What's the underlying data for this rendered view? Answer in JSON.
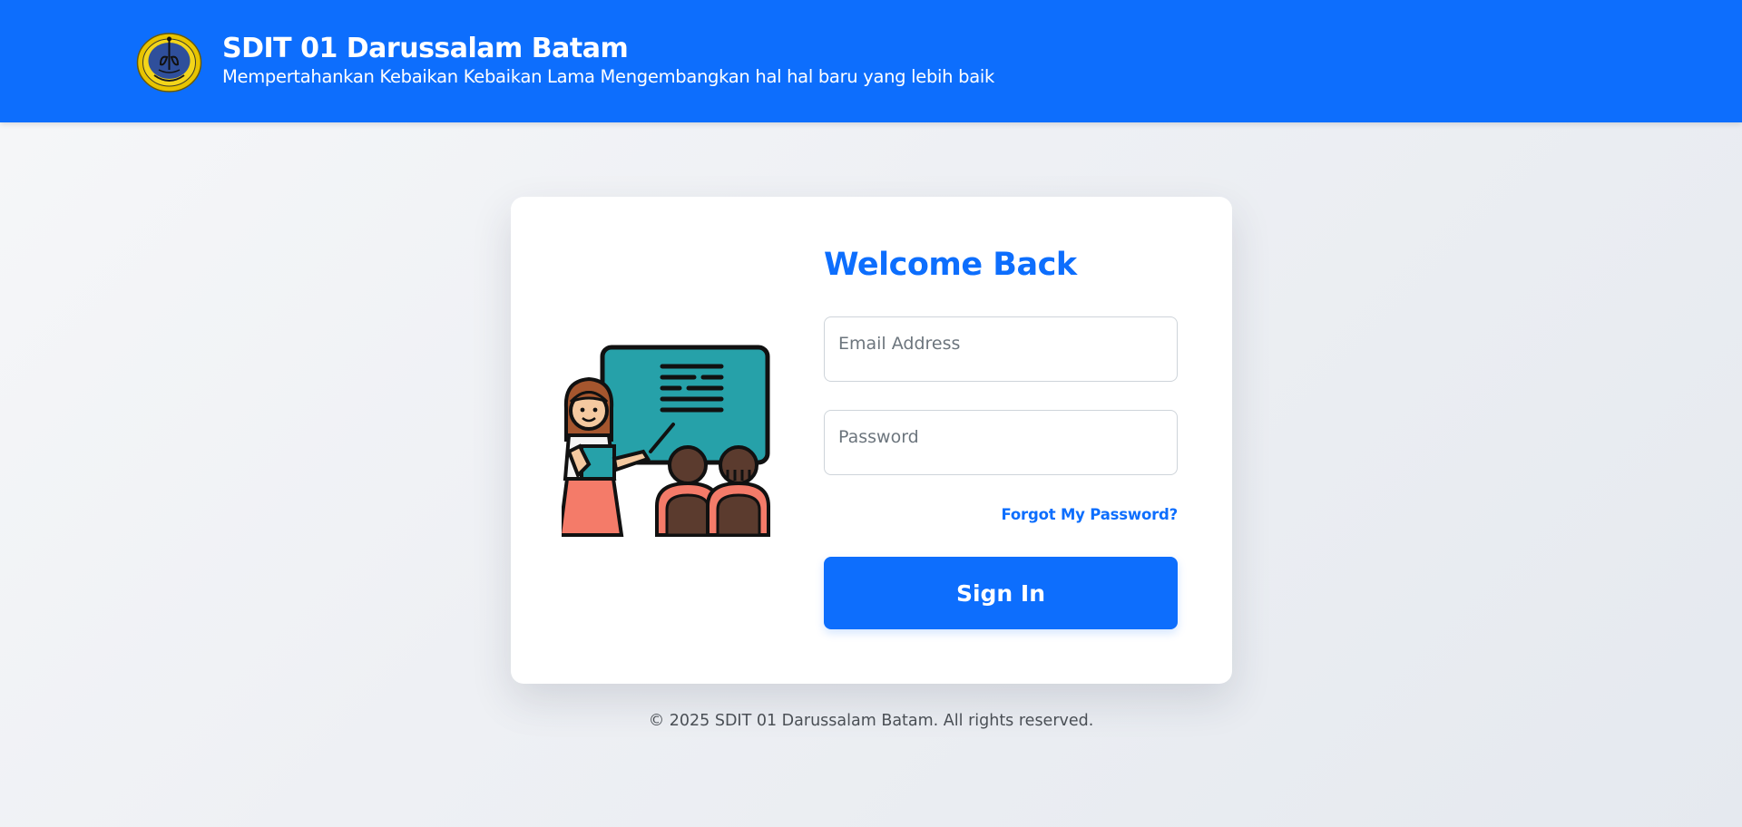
{
  "header": {
    "title": "SDIT 01 Darussalam Batam",
    "tagline": "Mempertahankan Kebaikan Kebaikan Lama Mengembangkan hal hal baru yang lebih baik",
    "logo_icon": "school-crest-icon",
    "background_color": "#0d6efd"
  },
  "login": {
    "heading": "Welcome Back",
    "illustration_icon": "teacher-classroom-illustration",
    "email": {
      "placeholder": "Email Address",
      "value": ""
    },
    "password": {
      "placeholder": "Password",
      "value": ""
    },
    "forgot_label": "Forgot My Password?",
    "submit_label": "Sign In",
    "accent_color": "#0d6efd"
  },
  "footer": {
    "copyright": "© 2025 SDIT 01 Darussalam Batam. All rights reserved."
  }
}
